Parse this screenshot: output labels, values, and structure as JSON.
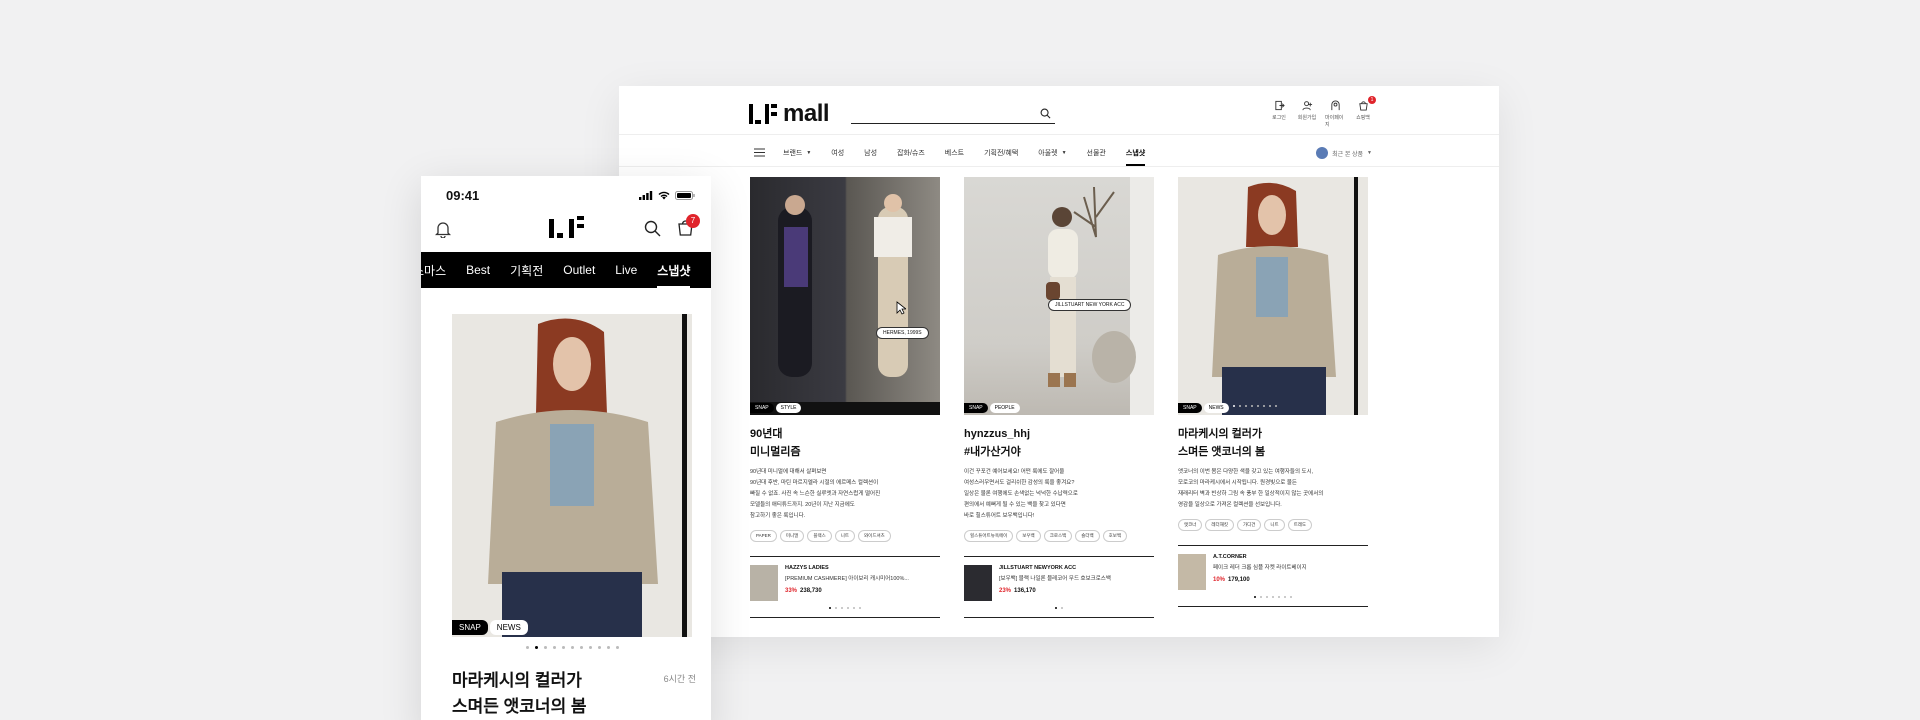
{
  "status_bar": {
    "time": "09:41"
  },
  "desktop": {
    "logo": {
      "brand": "mall"
    },
    "utility": [
      {
        "label": "로그인",
        "icon": "login-icon"
      },
      {
        "label": "회원가입",
        "icon": "join-icon"
      },
      {
        "label": "마이페이지",
        "icon": "mypage-icon"
      },
      {
        "label": "쇼핑백",
        "icon": "cart-icon"
      }
    ],
    "cart_count": "1",
    "nav": [
      {
        "label": "브랜드",
        "dropdown": true
      },
      {
        "label": "여성"
      },
      {
        "label": "남성"
      },
      {
        "label": "잡화/슈즈"
      },
      {
        "label": "베스트"
      },
      {
        "label": "기획전/혜택"
      },
      {
        "label": "아울렛",
        "dropdown": true
      },
      {
        "label": "선물관"
      },
      {
        "label": "스냅샷",
        "active": true
      }
    ],
    "recent": "최근 본 상품",
    "cards": [
      {
        "tag1": "SNAP",
        "tag2": "STYLE",
        "title1": "90년대",
        "title2": "미니멀리즘",
        "desc": [
          "90년대 미니멀에 대해서 살펴보면",
          "90년대 후반, 마틴 마르지엘라 시절의 에르메스 컬렉션이",
          "빠질 수 없죠. 사진 속 느슨한 실루엣과 자연스럽게 떨어진",
          "모델들의 애티튜드까지. 20년이 지난 지금에도",
          "참고하기 좋은 룩입니다."
        ],
        "hashtags": [
          "PAPER",
          "미니멀",
          "블랙스",
          "니트",
          "와이드셔츠"
        ],
        "tooltip": "HERMES, 1999S",
        "product": {
          "brand": "HAZZYS LADIES",
          "name": "[PREMIUM CASHMERE] 아이보리 캐시미어100%...",
          "pct": "33%",
          "price": "238,730"
        }
      },
      {
        "tag1": "SNAP",
        "tag2": "PEOPLE",
        "title1": "hynzzus_hhj",
        "title2": "#내가산거야",
        "desc": [
          "이건 꾸포건 예어보세요! 어떤 룩에도 잘어울",
          "여성스러우면서도 걸리쉬한 감성의 룩을 좋겨요?",
          "일상은 물론 여행에도 손색없는 넉넉한 수납력으로",
          "편의에서 예뻐게 될 수 있는 백을 찾고 있다면",
          "바로 힐스튜어트 보우백입니다!"
        ],
        "hashtags": [
          "힐스튜어트뉴욕에이",
          "보우백",
          "크로스백",
          "숄더백",
          "호보백"
        ],
        "tooltip": "JILLSTUART NEW YORK ACC",
        "product": {
          "brand": "JILLSTUART NEWYORK ACC",
          "name": "[보우백] 블랙 나일론 블레코어 무드 호보크로스백",
          "pct": "23%",
          "price": "136,170"
        }
      },
      {
        "tag1": "SNAP",
        "tag2": "NEWS",
        "title1": "마라케시의 컬러가",
        "title2": "스며든 앳코너의 봄",
        "desc": [
          "앳코너의 이번 봄은 다양한 색을 갖고 있는 여행자들의 도시,",
          "모로코의 마라케시에서 시작됩니다. 원경빛으로 물든",
          "재래리터 벽과 빈상하 그림 속 풍부 한 일상적이지 않는 곳에서의",
          "영감을 일상으로 가져온 컬렉션을 선보입니다."
        ],
        "hashtags": [
          "앳코너",
          "레더재킷",
          "가디건",
          "니트",
          "트레도"
        ],
        "product": {
          "brand": "A.T.CORNER",
          "name": "페이크 레더 크롭 심플 자켓 라이트베이지",
          "pct": "10%",
          "price": "179,100"
        }
      }
    ]
  },
  "mobile": {
    "cart_count": "7",
    "tabs": [
      "스마스",
      "Best",
      "기획전",
      "Outlet",
      "Live",
      "스냅샷"
    ],
    "active_tab": "스냅샷",
    "tag1": "SNAP",
    "tag2": "NEWS",
    "title1": "마라케시의 컬러가",
    "title2": "스며든 앳코너의 봄",
    "ago": "6시간 전"
  },
  "colors": {
    "accent": "#e0242b",
    "nav_bg": "#000000"
  }
}
